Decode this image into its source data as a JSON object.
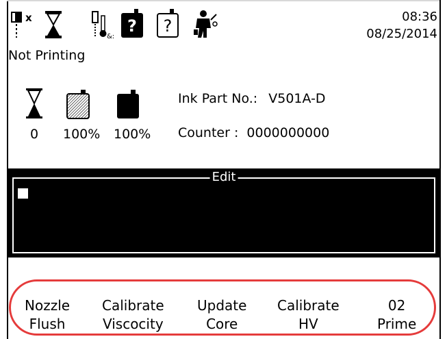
{
  "status_icons": [
    {
      "icon": "nozzle-closed-icon"
    },
    {
      "icon": "hourglass-icon"
    },
    {
      "icon": "temperature-icon"
    },
    {
      "icon": "ink-help-icon"
    },
    {
      "icon": "makeup-help-icon"
    },
    {
      "icon": "service-technician-icon"
    }
  ],
  "clock": {
    "time": "08:36",
    "date": "08/25/2014"
  },
  "printer_status": "Not Printing",
  "stats": {
    "hourglass_value": "0",
    "makeup_level": "100%",
    "ink_level": "100%"
  },
  "info": {
    "ink_part_label": "Ink Part No.:",
    "ink_part_value": "V501A-D",
    "counter_label": "Counter :",
    "counter_value": "0000000000"
  },
  "edit": {
    "title": "Edit"
  },
  "softkeys": [
    {
      "line1": "Nozzle",
      "line2": "Flush"
    },
    {
      "line1": "Calibrate",
      "line2": "Viscocity"
    },
    {
      "line1": "Update",
      "line2": "Core"
    },
    {
      "line1": "Calibrate",
      "line2": "HV"
    },
    {
      "line1": "02",
      "line2": "Prime"
    }
  ],
  "colors": {
    "background": "#ffffff",
    "panel": "#000000",
    "highlight": "#e53b3b"
  }
}
